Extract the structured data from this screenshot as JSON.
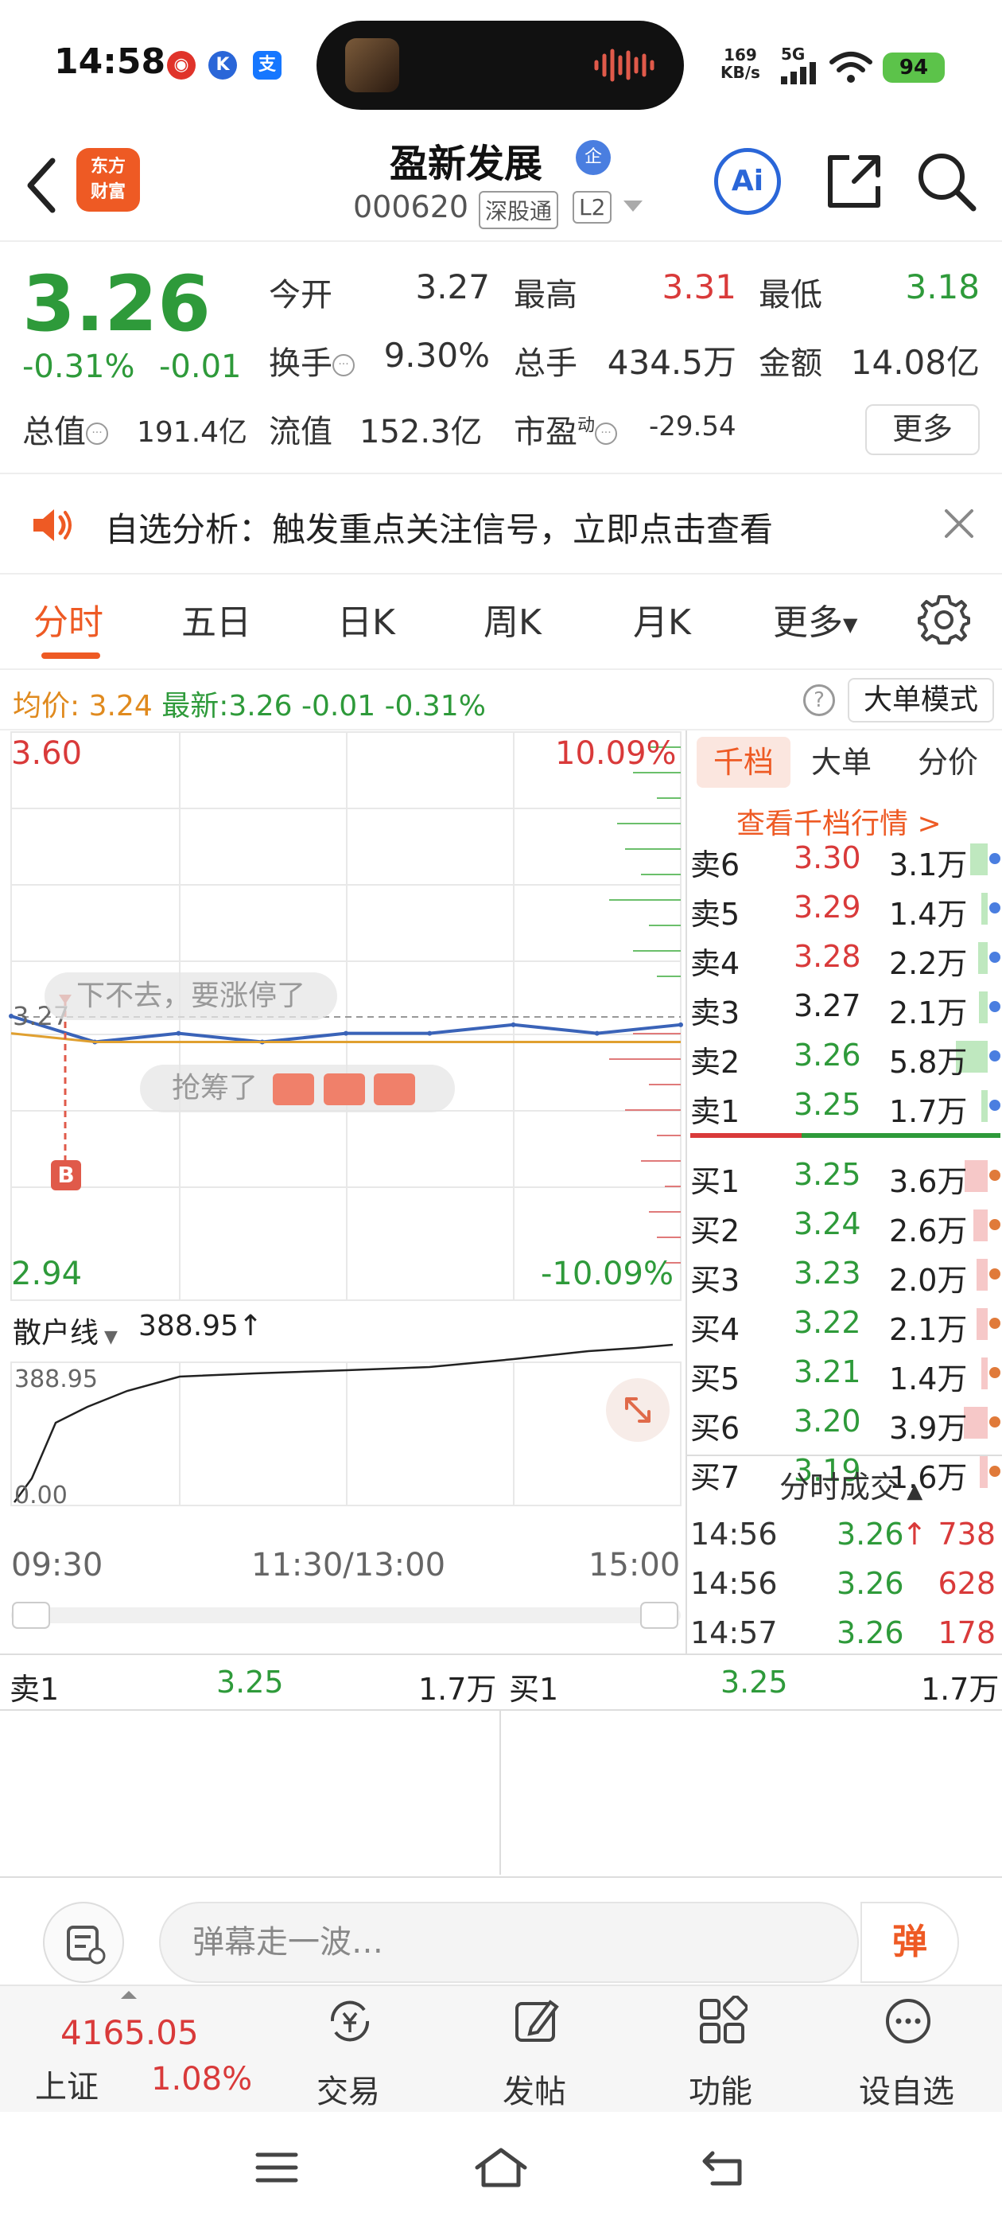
{
  "status_bar": {
    "time": "14:58",
    "net_speed": "169",
    "net_speed_unit": "KB/s",
    "signal_label": "5G",
    "battery": "94",
    "icons": [
      "weibo-icon",
      "k-app-icon",
      "alipay-icon"
    ]
  },
  "header": {
    "logo_line1": "东方",
    "logo_line2": "财富",
    "stock_name": "盈新发展",
    "badge": "企",
    "stock_code": "000620",
    "tag_sgt": "深股通",
    "tag_l2": "L2",
    "ai_label": "Ai"
  },
  "quote": {
    "price": "3.26",
    "change_pct": "-0.31%",
    "change_amt": "-0.01",
    "open_label": "今开",
    "open": "3.27",
    "high_label": "最高",
    "high": "3.31",
    "low_label": "最低",
    "low": "3.18",
    "turnover_label": "换手",
    "turnover": "9.30%",
    "volume_label": "总手",
    "volume": "434.5万",
    "amount_label": "金额",
    "amount": "14.08亿",
    "mktcap_label": "总值",
    "mktcap": "191.4亿",
    "float_label": "流值",
    "float": "152.3亿",
    "pe_label": "市盈",
    "pe_sup": "动",
    "pe": "-29.54",
    "more": "更多"
  },
  "notice": {
    "text": "自选分析：触发重点关注信号，立即点击查看"
  },
  "tabs": [
    "分时",
    "五日",
    "日K",
    "周K",
    "月K",
    "更多"
  ],
  "avg_bar": {
    "avg_label": "均价:",
    "avg": "3.24",
    "latest_label": "最新:",
    "latest": "3.26",
    "chg": "-0.01",
    "pct": "-0.31%",
    "mode": "大单模式"
  },
  "chart": {
    "y_top": "3.60",
    "y_bottom": "2.94",
    "pct_top": "10.09%",
    "pct_bottom": "-10.09%",
    "prev_close": "3.27",
    "overlay_1": "下不去，要涨停了",
    "overlay_2": "抢筹了",
    "marker": "B",
    "sub_indicator": "散户线",
    "sub_value": "388.95",
    "sub_top": "388.95",
    "sub_bottom": "0.00",
    "x_labels": [
      "09:30",
      "11:30/13:00",
      "15:00"
    ]
  },
  "chart_data": {
    "type": "line",
    "x": [
      "09:30",
      "10:00",
      "10:30",
      "11:00",
      "11:30/13:00",
      "13:30",
      "14:00",
      "14:30",
      "15:00"
    ],
    "series": [
      {
        "values": [
          3.27,
          3.24,
          3.25,
          3.24,
          3.25,
          3.25,
          3.26,
          3.25,
          3.26
        ]
      },
      {
        "values": [
          3.25,
          3.24,
          3.24,
          3.24,
          3.24,
          3.24,
          3.24,
          3.24,
          3.24
        ]
      }
    ],
    "ylim": [
      2.94,
      3.6
    ]
  },
  "orderbook": {
    "tabs": [
      "千档",
      "大单",
      "分价"
    ],
    "link": "查看千档行情 >",
    "asks": [
      {
        "label": "卖6",
        "price": "3.30",
        "vol": "3.1万",
        "bar": 0.27
      },
      {
        "label": "卖5",
        "price": "3.29",
        "vol": "1.4万",
        "bar": 0.1
      },
      {
        "label": "卖4",
        "price": "3.28",
        "vol": "2.2万",
        "bar": 0.15
      },
      {
        "label": "卖3",
        "price": "3.27",
        "vol": "2.1万",
        "bar": 0.14
      },
      {
        "label": "卖2",
        "price": "3.26",
        "vol": "5.8万",
        "bar": 0.5
      },
      {
        "label": "卖1",
        "price": "3.25",
        "vol": "1.7万",
        "bar": 0.1
      }
    ],
    "bids": [
      {
        "label": "买1",
        "price": "3.25",
        "vol": "3.6万",
        "bar": 0.36
      },
      {
        "label": "买2",
        "price": "3.24",
        "vol": "2.6万",
        "bar": 0.22
      },
      {
        "label": "买3",
        "price": "3.23",
        "vol": "2.0万",
        "bar": 0.17
      },
      {
        "label": "买4",
        "price": "3.22",
        "vol": "2.1万",
        "bar": 0.17
      },
      {
        "label": "买5",
        "price": "3.21",
        "vol": "1.4万",
        "bar": 0.1
      },
      {
        "label": "买6",
        "price": "3.20",
        "vol": "3.9万",
        "bar": 0.38
      },
      {
        "label": "买7",
        "price": "3.19",
        "vol": "1.6万",
        "bar": 0.12
      }
    ],
    "ticks_title": "分时成交",
    "ticks": [
      {
        "time": "14:56",
        "price": "3.26",
        "arrow": "↑",
        "vol": "738"
      },
      {
        "time": "14:56",
        "price": "3.26",
        "arrow": "",
        "vol": "628"
      },
      {
        "time": "14:57",
        "price": "3.26",
        "arrow": "",
        "vol": "178"
      }
    ]
  },
  "bid_bar": {
    "ask_label": "卖1",
    "ask_price": "3.25",
    "ask_vol": "1.7万",
    "bid_label": "买1",
    "bid_price": "3.25",
    "bid_vol": "1.7万"
  },
  "danmaku": {
    "placeholder": "弹幕走一波…",
    "send": "弹"
  },
  "bottom_nav": {
    "index_value": "4165.05",
    "index_name": "上证",
    "index_pct": "1.08%",
    "items": [
      "交易",
      "发帖",
      "功能",
      "设自选"
    ]
  },
  "colors": {
    "up": "#d93a3a",
    "down": "#2e9a3a",
    "accent": "#ee5a24",
    "price_line": "#3a63b8",
    "avg_line": "#e0a030"
  }
}
